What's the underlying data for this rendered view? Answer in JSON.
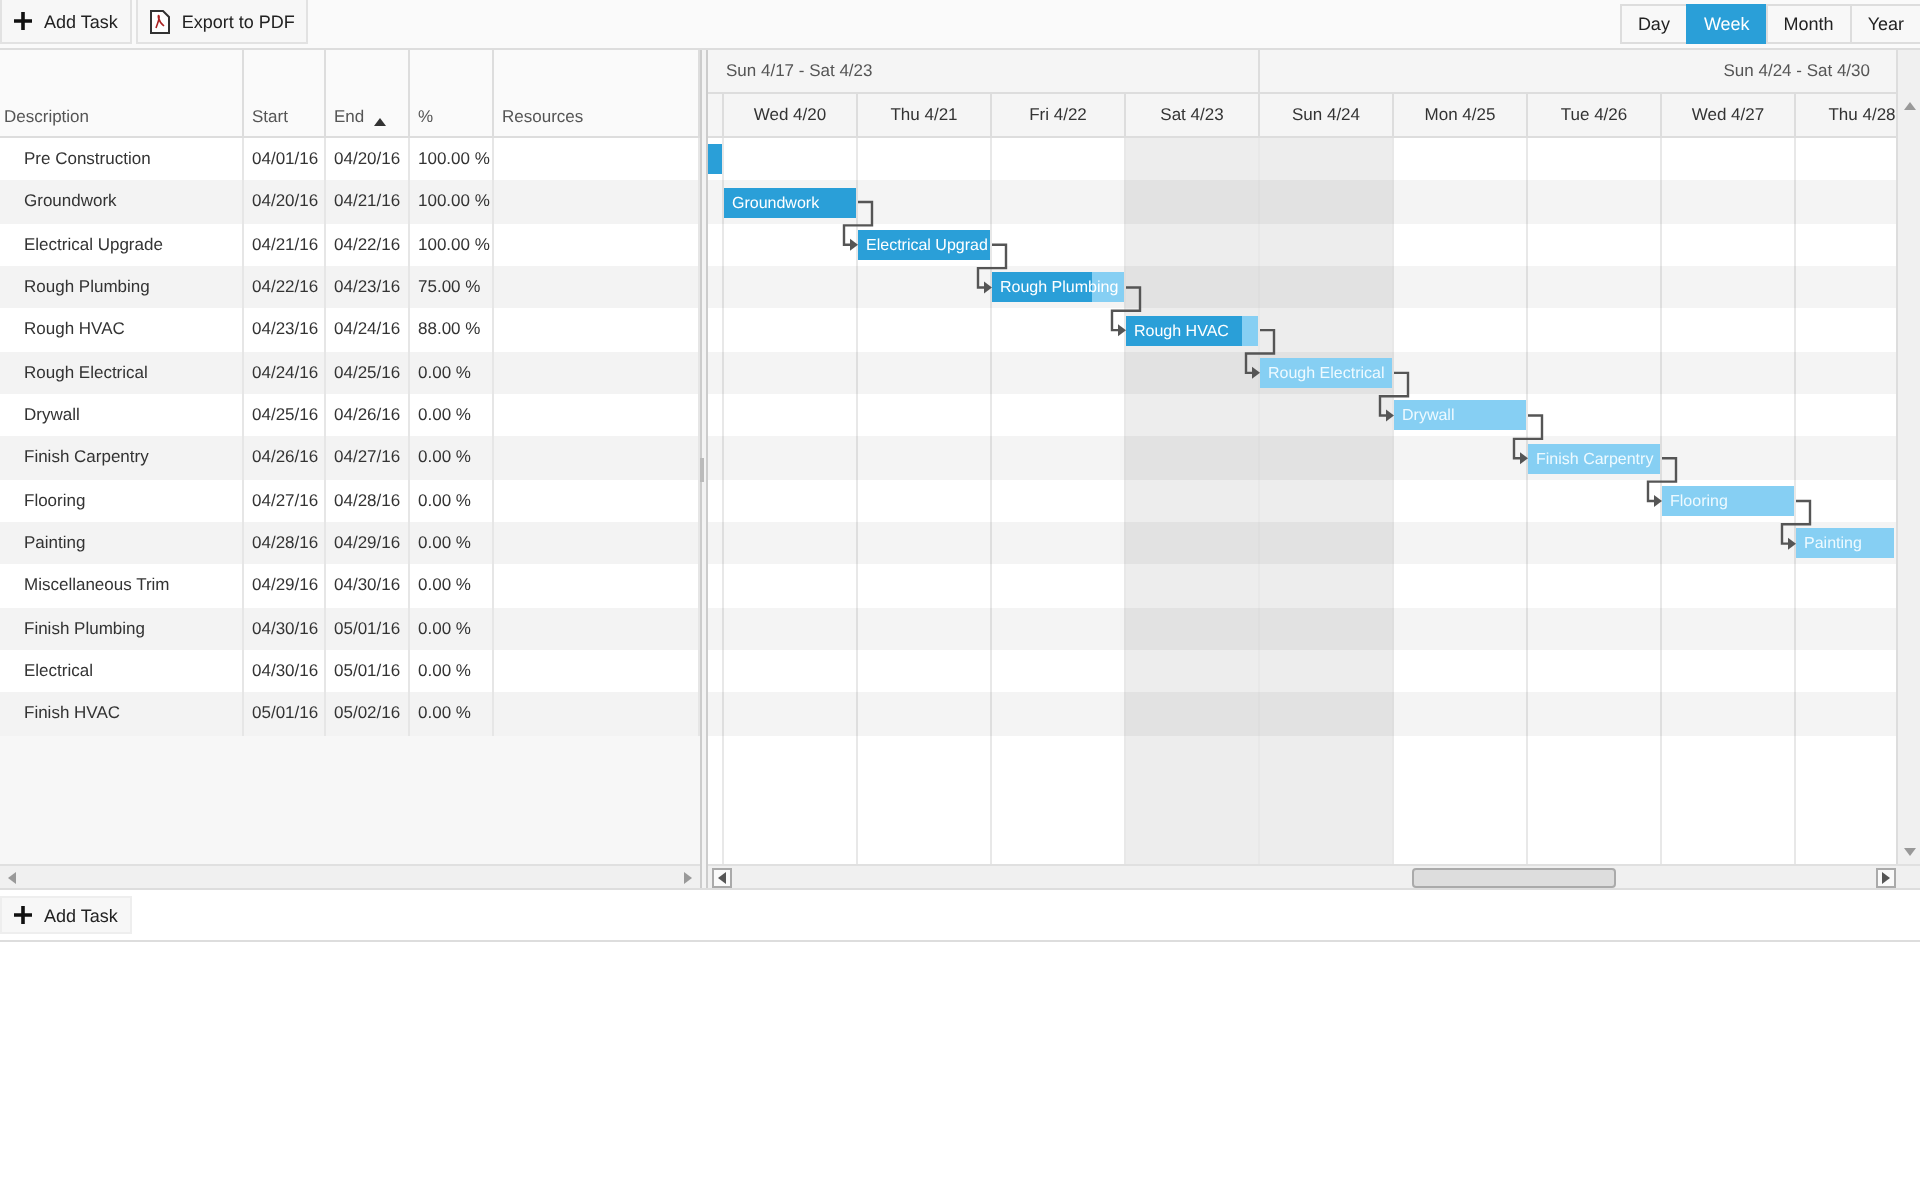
{
  "toolbar": {
    "buttons": [
      {
        "kind": "add",
        "label": "Add Task"
      },
      {
        "kind": "pdf",
        "label": "Export to PDF"
      }
    ],
    "views": [
      {
        "label": "Day",
        "selected": false
      },
      {
        "label": "Week",
        "selected": true
      },
      {
        "label": "Month",
        "selected": false
      },
      {
        "label": "Year",
        "selected": false
      }
    ]
  },
  "grid": {
    "columns": [
      {
        "label": "Description",
        "sorted": false
      },
      {
        "label": "Start",
        "sorted": false
      },
      {
        "label": "End",
        "sorted": true
      },
      {
        "label": "%",
        "sorted": false
      },
      {
        "label": "Resources",
        "sorted": false
      }
    ]
  },
  "timeline": {
    "weeks": [
      {
        "label": "Sun 4/17 - Sat 4/23"
      },
      {
        "label": "Sun 4/24 - Sat 4/30"
      }
    ],
    "days": [
      {
        "label": "Wed 4/20",
        "weekend": false
      },
      {
        "label": "Thu 4/21",
        "weekend": false
      },
      {
        "label": "Fri 4/22",
        "weekend": false
      },
      {
        "label": "Sat 4/23",
        "weekend": true
      },
      {
        "label": "Sun 4/24",
        "weekend": true
      },
      {
        "label": "Mon 4/25",
        "weekend": false
      },
      {
        "label": "Tue 4/26",
        "weekend": false
      },
      {
        "label": "Wed 4/27",
        "weekend": false
      },
      {
        "label": "Thu 4/28",
        "weekend": false
      }
    ]
  },
  "tasks": [
    {
      "description": "Pre Construction",
      "start": "04/01/16",
      "end": "04/20/16",
      "percent": "100.00 %",
      "level": 1
    },
    {
      "description": "Groundwork",
      "start": "04/20/16",
      "end": "04/21/16",
      "percent": "100.00 %",
      "level": 1,
      "bar_label": "Groundwork"
    },
    {
      "description": "Electrical Upgrade",
      "start": "04/21/16",
      "end": "04/22/16",
      "percent": "100.00 %",
      "level": 1,
      "bar_label": "Electrical Upgrad",
      "linked": true
    },
    {
      "description": "Rough Plumbing",
      "start": "04/22/16",
      "end": "04/23/16",
      "percent": "75.00 %",
      "level": 0.75,
      "bar_label": "Rough Plumbing",
      "linked": true
    },
    {
      "description": "Rough HVAC",
      "start": "04/23/16",
      "end": "04/24/16",
      "percent": "88.00 %",
      "level": 0.88,
      "bar_label": "Rough HVAC",
      "linked": true
    },
    {
      "description": "Rough Electrical",
      "start": "04/24/16",
      "end": "04/25/16",
      "percent": "0.00 %",
      "level": 0,
      "bar_label": "Rough Electrical",
      "linked": true
    },
    {
      "description": "Drywall",
      "start": "04/25/16",
      "end": "04/26/16",
      "percent": "0.00 %",
      "level": 0,
      "bar_label": "Drywall",
      "linked": true
    },
    {
      "description": "Finish Carpentry",
      "start": "04/26/16",
      "end": "04/27/16",
      "percent": "0.00 %",
      "level": 0,
      "bar_label": "Finish Carpentry",
      "linked": true
    },
    {
      "description": "Flooring",
      "start": "04/27/16",
      "end": "04/28/16",
      "percent": "0.00 %",
      "level": 0,
      "bar_label": "Flooring",
      "linked": true
    },
    {
      "description": "Painting",
      "start": "04/28/16",
      "end": "04/29/16",
      "percent": "0.00 %",
      "level": 0,
      "bar_label": "Painting",
      "linked": true
    },
    {
      "description": "Miscellaneous Trim",
      "start": "04/29/16",
      "end": "04/30/16",
      "percent": "0.00 %"
    },
    {
      "description": "Finish Plumbing",
      "start": "04/30/16",
      "end": "05/01/16",
      "percent": "0.00 %"
    },
    {
      "description": "Electrical",
      "start": "04/30/16",
      "end": "05/01/16",
      "percent": "0.00 %"
    },
    {
      "description": "Finish HVAC",
      "start": "05/01/16",
      "end": "05/02/16",
      "percent": "0.00 %"
    }
  ],
  "footer": {
    "button": {
      "label": "Add Task"
    }
  }
}
